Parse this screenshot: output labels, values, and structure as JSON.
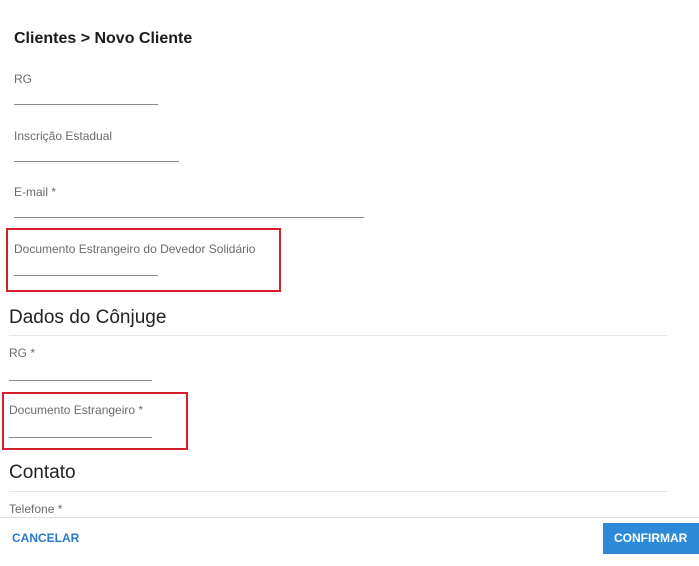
{
  "breadcrumb": "Clientes > Novo Cliente",
  "fields": {
    "rg": {
      "label": "RG",
      "value": ""
    },
    "inscricao_estadual": {
      "label": "Inscrição Estadual",
      "value": ""
    },
    "email": {
      "label": "E-mail *",
      "value": ""
    },
    "documento_estrangeiro_devedor": {
      "label": "Documento Estrangeiro do Devedor Solidário",
      "value": ""
    }
  },
  "conjuge": {
    "heading": "Dados do Cônjuge",
    "rg": {
      "label": "RG *",
      "value": ""
    },
    "documento_estrangeiro": {
      "label": "Documento Estrangeiro *",
      "value": ""
    }
  },
  "contato": {
    "heading": "Contato",
    "telefone": {
      "label": "Telefone *"
    }
  },
  "actions": {
    "cancel_label": "CANCELAR",
    "confirm_label": "CONFIRMAR"
  },
  "colors": {
    "accent": "#2e8ad8",
    "link": "#2879c8",
    "highlight": "#d6202b"
  }
}
